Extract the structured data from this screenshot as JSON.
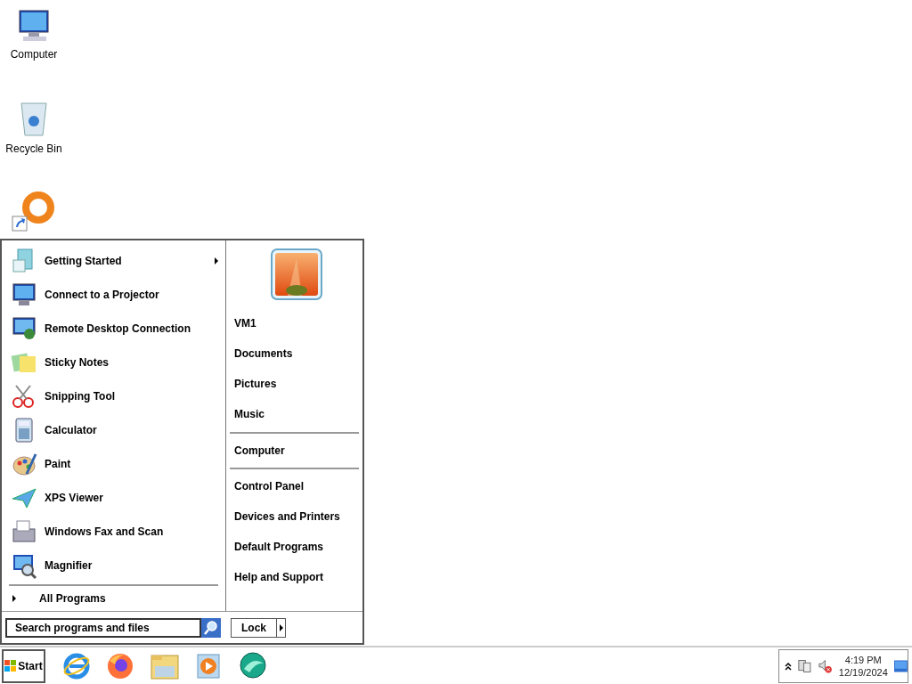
{
  "desktop_icons": [
    {
      "label": "Computer"
    },
    {
      "label": "Recycle Bin"
    }
  ],
  "start_menu": {
    "programs": [
      {
        "label": "Getting Started",
        "has_submenu": true
      },
      {
        "label": "Connect to a Projector",
        "has_submenu": false
      },
      {
        "label": "Remote Desktop Connection",
        "has_submenu": false
      },
      {
        "label": "Sticky Notes",
        "has_submenu": false
      },
      {
        "label": "Snipping Tool",
        "has_submenu": false
      },
      {
        "label": "Calculator",
        "has_submenu": false
      },
      {
        "label": "Paint",
        "has_submenu": false
      },
      {
        "label": "XPS Viewer",
        "has_submenu": false
      },
      {
        "label": "Windows Fax and Scan",
        "has_submenu": false
      },
      {
        "label": "Magnifier",
        "has_submenu": false
      }
    ],
    "all_programs": "All Programs",
    "search": {
      "placeholder": "Search programs and files"
    },
    "right_groups": [
      [
        "VM1",
        "Documents",
        "Pictures",
        "Music"
      ],
      [
        "Computer"
      ],
      [
        "Control Panel",
        "Devices and Printers",
        "Default Programs",
        "Help and Support"
      ]
    ],
    "power_button": "Lock"
  },
  "taskbar": {
    "start": "Start",
    "clock_time": "4:19 PM",
    "clock_date": "12/19/2024"
  }
}
